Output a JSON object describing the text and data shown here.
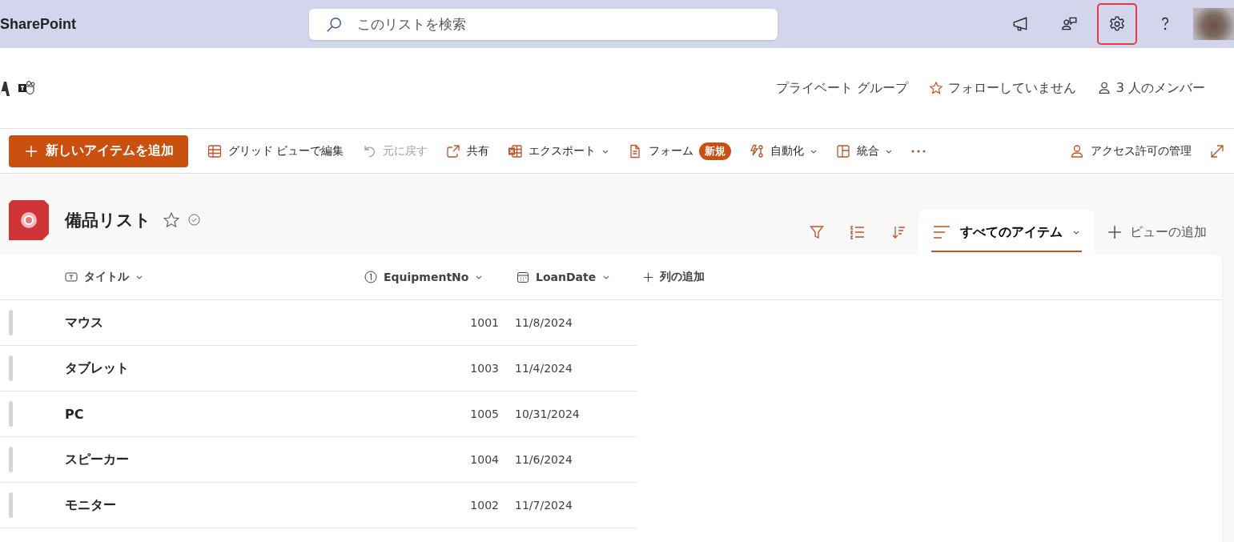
{
  "app_bar": {
    "brand": "SharePoint",
    "search": {
      "placeholder": "このリストを検索"
    },
    "icons": [
      {
        "kind": "megaphone",
        "highlighted": false
      },
      {
        "kind": "people-chat",
        "highlighted": false
      },
      {
        "kind": "settings",
        "highlighted": true
      },
      {
        "kind": "help",
        "highlighted": false
      },
      {
        "kind": "avatar",
        "highlighted": false
      }
    ]
  },
  "site_header": {
    "links": [
      {
        "kind": "text",
        "label": "プライベート グループ"
      },
      {
        "kind": "star",
        "label": "フォローしていません"
      },
      {
        "kind": "person",
        "label": "3 人のメンバー"
      }
    ]
  },
  "command_bar": {
    "primary": {
      "label": "新しいアイテムを追加"
    },
    "commands": [
      {
        "kind": "grid",
        "label": "グリッド ビューで編集",
        "disabled": false,
        "dropdown": false
      },
      {
        "kind": "undo",
        "label": "元に戻す",
        "disabled": true,
        "dropdown": false
      },
      {
        "kind": "share",
        "label": "共有",
        "disabled": false,
        "dropdown": false
      },
      {
        "kind": "excel",
        "label": "エクスポート",
        "disabled": false,
        "dropdown": true
      },
      {
        "kind": "form",
        "label": "フォーム",
        "badge": "新規",
        "disabled": false,
        "dropdown": false
      },
      {
        "kind": "automate",
        "label": "自動化",
        "disabled": false,
        "dropdown": true
      },
      {
        "kind": "integrate",
        "label": "統合",
        "disabled": false,
        "dropdown": true
      },
      {
        "kind": "more"
      }
    ],
    "right": [
      {
        "kind": "access",
        "label": "アクセス許可の管理"
      },
      {
        "kind": "expand"
      }
    ]
  },
  "list": {
    "title": "備品リスト",
    "favorite": false,
    "tools": [
      {
        "kind": "filter"
      },
      {
        "kind": "group"
      },
      {
        "kind": "sort"
      }
    ],
    "views": [
      {
        "label": "すべてのアイテム",
        "selected": true
      }
    ],
    "add_view": "ビューの追加"
  },
  "table": {
    "columns": [
      {
        "kind": "text",
        "label": "タイトル"
      },
      {
        "kind": "number",
        "label": "EquipmentNo"
      },
      {
        "kind": "date",
        "label": "LoanDate"
      }
    ],
    "add_column": "列の追加",
    "rows": [
      {
        "title": "マウス",
        "equipment_no": "1001",
        "loan_date": "11/8/2024"
      },
      {
        "title": "タブレット",
        "equipment_no": "1003",
        "loan_date": "11/4/2024"
      },
      {
        "title": "PC",
        "equipment_no": "1005",
        "loan_date": "10/31/2024"
      },
      {
        "title": "スピーカー",
        "equipment_no": "1004",
        "loan_date": "11/6/2024"
      },
      {
        "title": "モニター",
        "equipment_no": "1002",
        "loan_date": "11/7/2024"
      }
    ]
  }
}
